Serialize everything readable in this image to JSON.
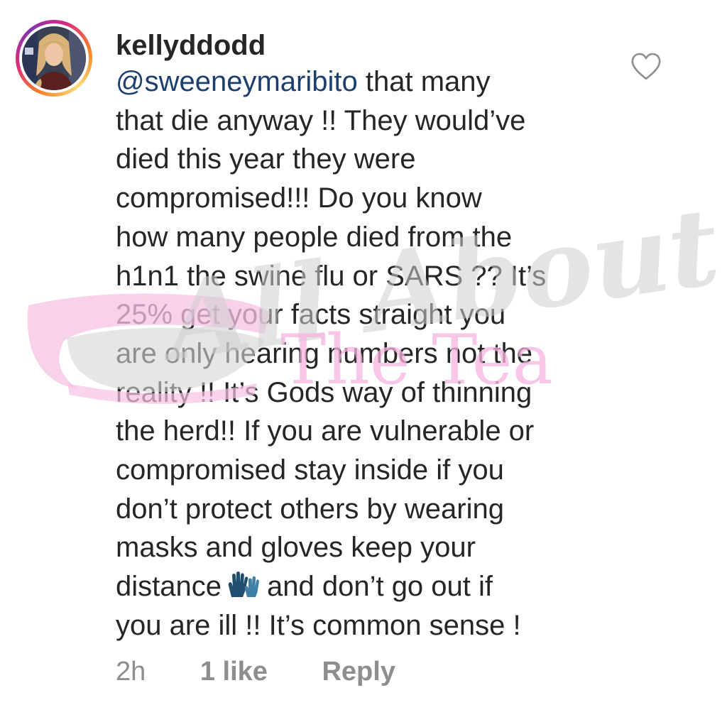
{
  "comment": {
    "username": "kellyddodd",
    "mention": "@sweeneymaribito",
    "lines": [
      " that many",
      "that die anyway !! They would’ve",
      "died this year they were",
      "compromised!!! Do you know",
      "how many people died from the",
      "h1n1 the swine flu or SARS ?? It’s",
      "25%  get your facts straight you",
      "are only hearing numbers not the",
      "reality !! It’s Gods way of thinning",
      "the herd!! If you are vulnerable or",
      "compromised stay inside if you",
      "don’t protect others by wearing",
      "masks and gloves keep your"
    ],
    "line14_before_emoji": "distance",
    "emoji_icon": "gloves-emoji-icon",
    "line14_after_emoji": "and don’t go out if",
    "line15": "you are ill !! It’s common sense !",
    "time": "2h",
    "likes": "1 like",
    "reply_label": "Reply",
    "heart_icon": "heart-outline-icon"
  },
  "watermark": {
    "script_text": "All About",
    "tea_text": "The Tea"
  },
  "colors": {
    "text": "#262626",
    "mention": "#1d3f6e",
    "meta": "#8e8e8e",
    "watermark_gray": "#cfcfcf",
    "watermark_pink": "#f6b4df"
  }
}
